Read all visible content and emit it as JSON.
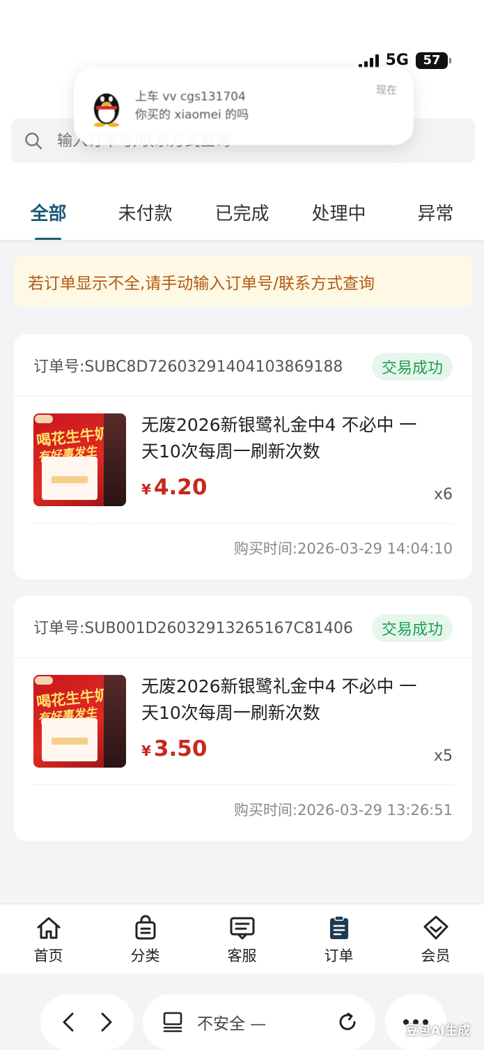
{
  "status_bar": {
    "network": "5G",
    "battery": "57"
  },
  "notification": {
    "line1": "上车 vv cgs131704",
    "line2": "你买的 xiaomei 的吗",
    "time": "现在"
  },
  "search": {
    "placeholder": "输入订单号/联系方式查询"
  },
  "tabs": [
    {
      "label": "全部",
      "active": true
    },
    {
      "label": "未付款",
      "active": false
    },
    {
      "label": "已完成",
      "active": false
    },
    {
      "label": "处理中",
      "active": false
    },
    {
      "label": "异常",
      "active": false
    }
  ],
  "notice": "若订单显示不全,请手动输入订单号/联系方式查询",
  "orders": [
    {
      "order_no_label": "订单号:SUBC8D72603291404103869188",
      "status": "交易成功",
      "product_title": "无废2026新银鹭礼金中4 不必中 一天10次每周一刷新次数",
      "currency": "¥",
      "price": "4.20",
      "qty": "x6",
      "time": "购买时间:2026-03-29 14:04:10",
      "thumb_text1": "喝花生牛奶",
      "thumb_text2": "有好事发生"
    },
    {
      "order_no_label": "订单号:SUB001D26032913265167C81406",
      "status": "交易成功",
      "product_title": "无废2026新银鹭礼金中4 不必中 一天10次每周一刷新次数",
      "currency": "¥",
      "price": "3.50",
      "qty": "x5",
      "time": "购买时间:2026-03-29 13:26:51",
      "thumb_text1": "喝花生牛奶",
      "thumb_text2": "有好事发生"
    }
  ],
  "bottom_nav": [
    {
      "label": "首页",
      "icon": "home-icon"
    },
    {
      "label": "分类",
      "icon": "bag-icon"
    },
    {
      "label": "客服",
      "icon": "chat-icon"
    },
    {
      "label": "订单",
      "icon": "clipboard-icon",
      "active": true
    },
    {
      "label": "会员",
      "icon": "diamond-icon"
    }
  ],
  "browser": {
    "address": "不安全 —"
  },
  "watermark": "豆包AI生成",
  "colors": {
    "accent": "#1c5b7a",
    "price": "#c7281e",
    "success_bg": "#e6f6ec",
    "success_text": "#1e9e55",
    "notice_bg": "#fdf9e5",
    "notice_text": "#b35a12"
  }
}
